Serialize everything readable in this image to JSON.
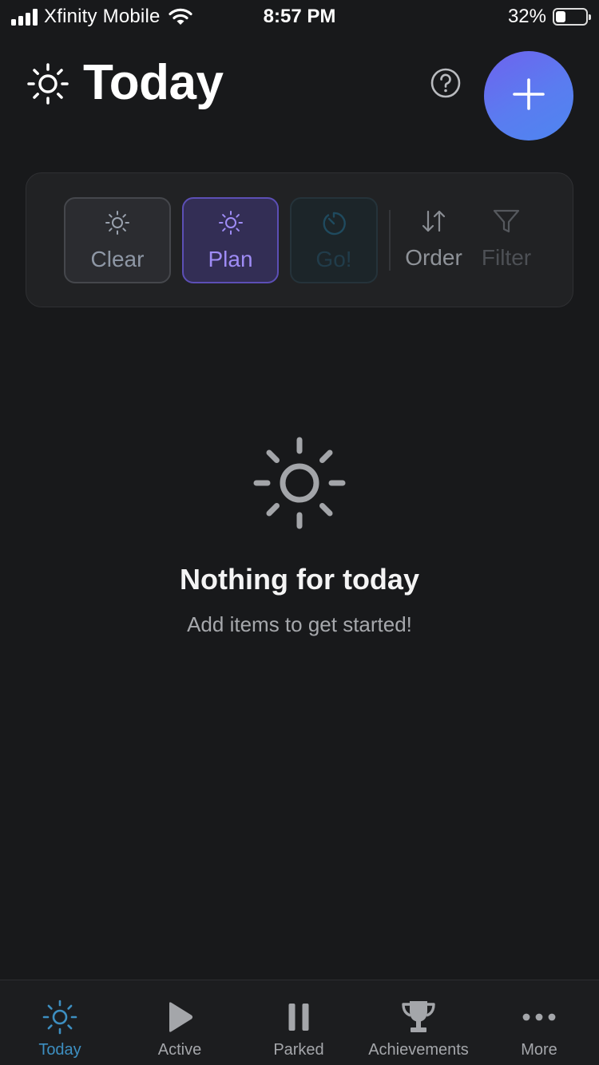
{
  "status_bar": {
    "carrier": "Xfinity Mobile",
    "time": "8:57 PM",
    "battery_percent": "32%",
    "battery_level": 0.32,
    "signal_bars": 4,
    "icons": [
      "signal-icon",
      "wifi-icon",
      "battery-icon"
    ]
  },
  "header": {
    "title": "Today",
    "icons": [
      "sun-icon",
      "help-icon",
      "plus-icon"
    ]
  },
  "toolbar": {
    "buttons": [
      {
        "label": "Clear",
        "icon": "sun-icon",
        "state": "default"
      },
      {
        "label": "Plan",
        "icon": "sun-icon",
        "state": "selected"
      },
      {
        "label": "Go!",
        "icon": "timer-icon",
        "state": "disabled"
      },
      {
        "label": "Order",
        "icon": "sort-icon",
        "state": "default"
      },
      {
        "label": "Filter",
        "icon": "filter-icon",
        "state": "disabled"
      }
    ]
  },
  "empty_state": {
    "icon": "sun-icon",
    "title": "Nothing for today",
    "subtitle": "Add items to get started!"
  },
  "tab_bar": {
    "selected": "Today",
    "tabs": [
      {
        "label": "Today",
        "icon": "sun-icon"
      },
      {
        "label": "Active",
        "icon": "play-icon"
      },
      {
        "label": "Parked",
        "icon": "pause-icon"
      },
      {
        "label": "Achievements",
        "icon": "trophy-icon"
      },
      {
        "label": "More",
        "icon": "ellipsis-icon"
      }
    ]
  },
  "colors": {
    "background": "#18191b",
    "accent_blue": "#3d8fc1",
    "accent_purple": "#9f8cf6",
    "fab_gradient_start": "#6e63ee",
    "fab_gradient_end": "#4e86f0"
  }
}
